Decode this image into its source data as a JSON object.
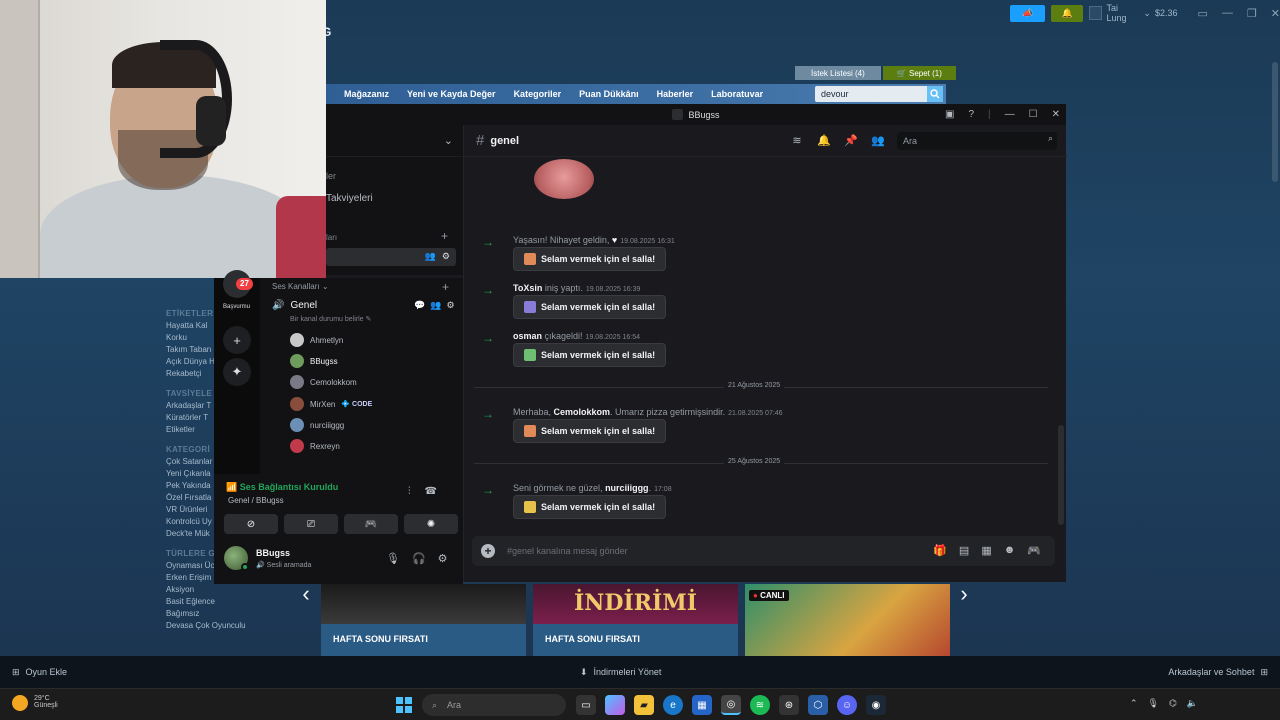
{
  "steam": {
    "topbar": {
      "user": "Tai Lung",
      "balance": "$2.36"
    },
    "logo_fragment": "G",
    "wishlist": "İstek Listesi (4)",
    "cart": "Sepet (1)",
    "nav": [
      "Mağazanız",
      "Yeni ve Kayda Değer",
      "Kategoriler",
      "Puan Dükkânı",
      "Haberler",
      "Laboratuvar"
    ],
    "search_value": "devour",
    "sidebar": {
      "etiketler_header": "ETİKETLER",
      "etiketler": [
        "Hayatta Kal",
        "Korku",
        "Takım Taban",
        "Açık Dünya H",
        "Rekabetçi"
      ],
      "tavsiye_header": "TAVSİYELE",
      "tavsiye": [
        "Arkadaşlar T",
        "Küratörler T",
        "Etiketler"
      ],
      "kategori_header": "KATEGORİ",
      "kategori": [
        "Çok Satanlar",
        "Yeni Çıkanla",
        "Pek Yakında",
        "Özel Fırsatla",
        "VR Ürünleri",
        "Kontrolcü Uy",
        "Deck'te Mük"
      ],
      "turler_header": "TÜRLERE G",
      "turler": [
        "Oynaması Ücretsiz",
        "Erken Erişim",
        "Aksiyon",
        "Basit Eğlence",
        "Bağımsız",
        "Devasa Çok Oyunculu"
      ]
    },
    "cards": [
      {
        "art_text": "",
        "label": "HAFTA SONU FIRSATI"
      },
      {
        "art_text": "İNDİRİMİ",
        "label": "HAFTA SONU FIRSATI"
      },
      {
        "art_text": "CANLI",
        "label": ""
      }
    ],
    "bottom": {
      "add_game": "Oyun Ekle",
      "downloads": "İndirmeleri Yönet",
      "friends": "Arkadaşlar ve Sohbet"
    }
  },
  "discord": {
    "window_title": "BBugss",
    "channel_name": "genel",
    "search_placeholder": "Ara",
    "left_partial": {
      "item1": "ler",
      "item2": "Takviyeleri",
      "item3": "ları"
    },
    "rail_badge": "27",
    "rail_label": "Başvurmu",
    "voice_header": "Ses Kanalları",
    "voice_channel": "Genel",
    "voice_status": "Bir kanal durumu belirle",
    "members": [
      {
        "name": "Ahmetlyn",
        "color": "#c8c8c8"
      },
      {
        "name": "BBugss",
        "color": "#6f9b5c"
      },
      {
        "name": "Cemolokkom",
        "color": "#7a7a86"
      },
      {
        "name": "MirXen",
        "color": "#8a4d3c",
        "badge": "CODE"
      },
      {
        "name": "nurciiiggg",
        "color": "#6b8fb5"
      },
      {
        "name": "Rexreyn",
        "color": "#c03a4a"
      }
    ],
    "messages": [
      {
        "pre": "Yaşasın! Nihayet geldin, ",
        "user": "♥",
        "post": "",
        "time": "19.08.2025 16:31",
        "button": "Selam vermek için el salla!"
      },
      {
        "pre": "",
        "user": "ToXsin",
        "post": " iniş yaptı.",
        "time": "19.08.2025 16:39",
        "button": "Selam vermek için el salla!"
      },
      {
        "pre": "",
        "user": "osman",
        "post": " çıkageldi!",
        "time": "19.08.2025 16:54",
        "button": "Selam vermek için el salla!"
      },
      {
        "pre": "Merhaba, ",
        "user": "Cemolokkom",
        "post": ". Umarız pizza getirmişsindir.",
        "time": "21.08.2025 07:46",
        "button": "Selam vermek için el salla!"
      },
      {
        "pre": "Seni görmek ne güzel, ",
        "user": "nurciiiggg",
        "post": ".",
        "time": "17:08",
        "button": "Selam vermek için el salla!"
      }
    ],
    "date_dividers": [
      "21 Ağustos 2025",
      "25 Ağustos 2025"
    ],
    "composer_placeholder": "#genel kanalına mesaj gönder",
    "connection": {
      "title": "Ses Bağlantısı Kuruldu",
      "sub": "Genel / BBugss"
    },
    "user": {
      "name": "BBugss",
      "status": "Sesli aramada"
    }
  },
  "taskbar": {
    "search": "Ara",
    "weather_temp": "29°C",
    "weather_desc": "Güneşli"
  }
}
